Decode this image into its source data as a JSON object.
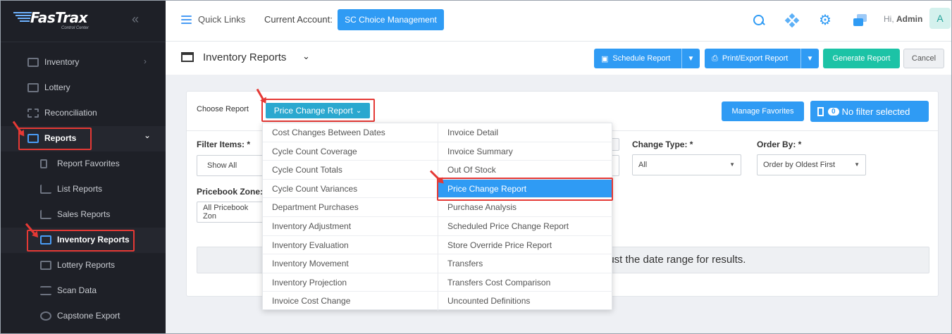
{
  "brand": {
    "name": "FasTrax",
    "subtitle": "Control Center"
  },
  "sidebar": {
    "items": [
      {
        "label": "Inventory",
        "icon": "inventory-icon",
        "chevron": "›"
      },
      {
        "label": "Lottery",
        "icon": "lottery-icon"
      },
      {
        "label": "Reconciliation",
        "icon": "reconciliation-icon"
      },
      {
        "label": "Reports",
        "icon": "bar-chart-icon",
        "chevron": "⌄",
        "expanded": true
      },
      {
        "label": "Report Favorites",
        "icon": "bookmark-icon"
      },
      {
        "label": "List Reports",
        "icon": "line-chart-icon"
      },
      {
        "label": "Sales Reports",
        "icon": "line-chart-icon"
      },
      {
        "label": "Inventory Reports",
        "icon": "warehouse-icon",
        "active": true
      },
      {
        "label": "Lottery Reports",
        "icon": "ticket-icon"
      },
      {
        "label": "Scan Data",
        "icon": "list-icon"
      },
      {
        "label": "Capstone Export",
        "icon": "export-icon"
      }
    ]
  },
  "topbar": {
    "quick_links": "Quick Links",
    "account_label": "Current Account:",
    "account_value": "SC Choice Management",
    "greeting": "Hi,",
    "user": "Admin",
    "avatar_initial": "A"
  },
  "page": {
    "title": "Inventory Reports"
  },
  "toolbar": {
    "schedule": "Schedule Report",
    "print_export": "Print/Export Report",
    "generate": "Generate Report",
    "cancel": "Cancel"
  },
  "panel": {
    "choose_label": "Choose Report",
    "selected_report": "Price Change Report",
    "manage_favorites": "Manage Favorites",
    "filter_count": "0",
    "filter_status": "No filter selected",
    "filter_items_label": "Filter Items: *",
    "filter_items_value": "Show All",
    "change_type_label": "Change Type: *",
    "change_type_value": "All",
    "order_by_label": "Order By: *",
    "order_by_value": "Order by Oldest First",
    "pricebook_label": "Pricebook Zone:",
    "pricebook_value": "All Pricebook Zon",
    "notice": "just the date range for results."
  },
  "dropdown": {
    "col1": [
      "Cost Changes Between Dates",
      "Cycle Count Coverage",
      "Cycle Count Totals",
      "Cycle Count Variances",
      "Department Purchases",
      "Inventory Adjustment",
      "Inventory Evaluation",
      "Inventory Movement",
      "Inventory Projection",
      "Invoice Cost Change"
    ],
    "col2": [
      "Invoice Detail",
      "Invoice Summary",
      "Out Of Stock",
      "Price Change Report",
      "Purchase Analysis",
      "Scheduled Price Change Report",
      "Store Override Price Report",
      "Transfers",
      "Transfers Cost Comparison",
      "Uncounted Definitions"
    ],
    "selected": "Price Change Report"
  },
  "colors": {
    "sidebar_bg": "#1e2027",
    "accent": "#2f9bf4",
    "teal": "#1cc3a6",
    "highlight": "#e53935"
  }
}
